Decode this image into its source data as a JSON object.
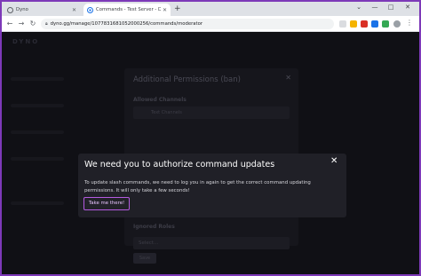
{
  "browser": {
    "tabs": [
      {
        "title": "Dyno",
        "active": false
      },
      {
        "title": "Commands - Test Server - Dyno",
        "active": true
      }
    ],
    "new_tab": "+",
    "window_controls": [
      "⌄",
      "—",
      "□",
      "✕"
    ],
    "url": "dyno.gg/manage/1077831681052000256/commands/moderator"
  },
  "app": {
    "logo": "DYNO"
  },
  "background_modal": {
    "title": "Additional Permissions (ban)",
    "allowed_channels_label": "Allowed Channels",
    "channel_select_value": "Text Channels",
    "ignored_roles_label": "Ignored Roles",
    "role_select_placeholder": "Select...",
    "save_label": "Save"
  },
  "auth_modal": {
    "title": "We need you to authorize command updates",
    "body": "To update slash commands, we need to log you in again to get the correct command updating permissions. It will only take a few seconds!",
    "button_label": "Take me there!",
    "accent_color": "#b45ae0"
  },
  "colors": {
    "frame_border": "#7d39b8",
    "page_background": "#101015",
    "modal_background": "#202027"
  }
}
